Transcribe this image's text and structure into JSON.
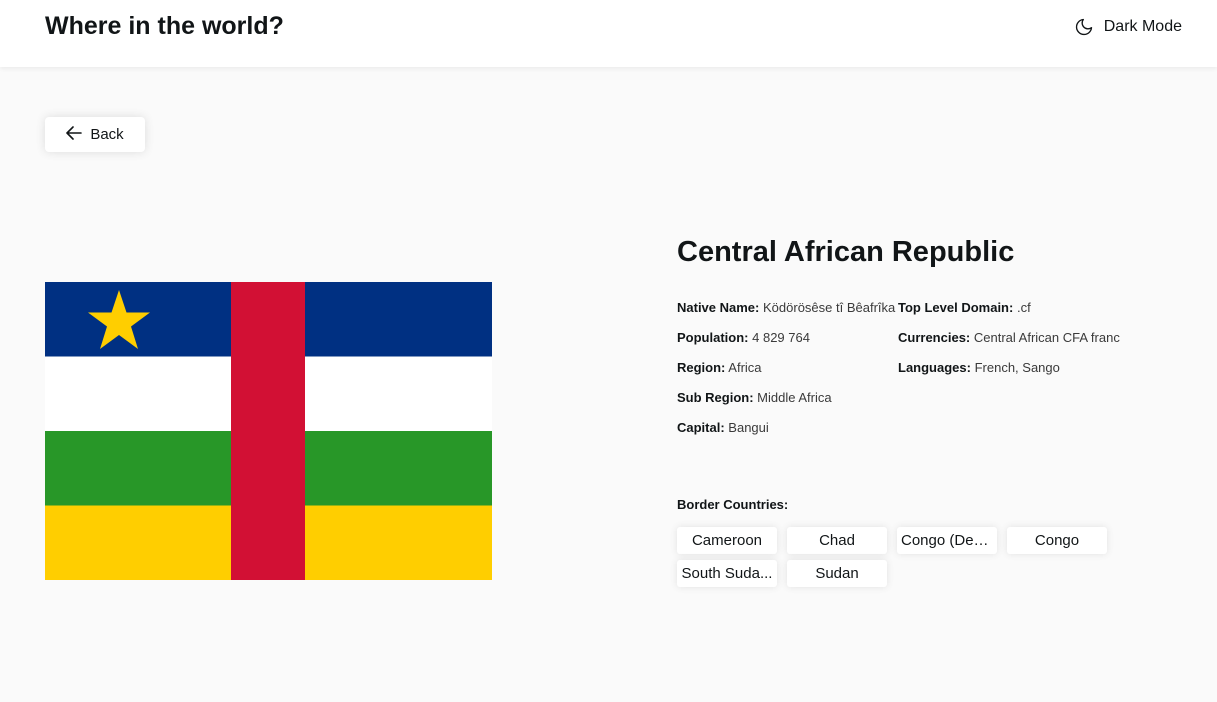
{
  "header": {
    "title": "Where in the world?",
    "dark_mode_label": "Dark Mode",
    "dark_mode_icon": "moon-icon"
  },
  "back_button": {
    "label": "Back",
    "icon": "arrow-left-icon"
  },
  "country": {
    "name": "Central African Republic",
    "flag": {
      "colors": {
        "blue": "#003082",
        "white": "#ffffff",
        "green": "#289728",
        "yellow": "#ffce00",
        "red": "#d21034",
        "star": "#ffce00"
      }
    },
    "left_details": [
      {
        "key": "Native Name:",
        "value": "Ködörösêse tî Bêafrîka"
      },
      {
        "key": "Population:",
        "value": "4 829 764"
      },
      {
        "key": "Region:",
        "value": "Africa"
      },
      {
        "key": "Sub Region:",
        "value": "Middle Africa"
      },
      {
        "key": "Capital:",
        "value": "Bangui"
      }
    ],
    "right_details": [
      {
        "key": "Top Level Domain:",
        "value": ".cf"
      },
      {
        "key": "Currencies:",
        "value": "Central African CFA franc"
      },
      {
        "key": "Languages:",
        "value": "French, Sango"
      }
    ],
    "border_label": "Border Countries:",
    "borders": [
      "Cameroon",
      "Chad",
      "Congo (Dem...",
      "Congo",
      "South Suda...",
      "Sudan"
    ]
  }
}
